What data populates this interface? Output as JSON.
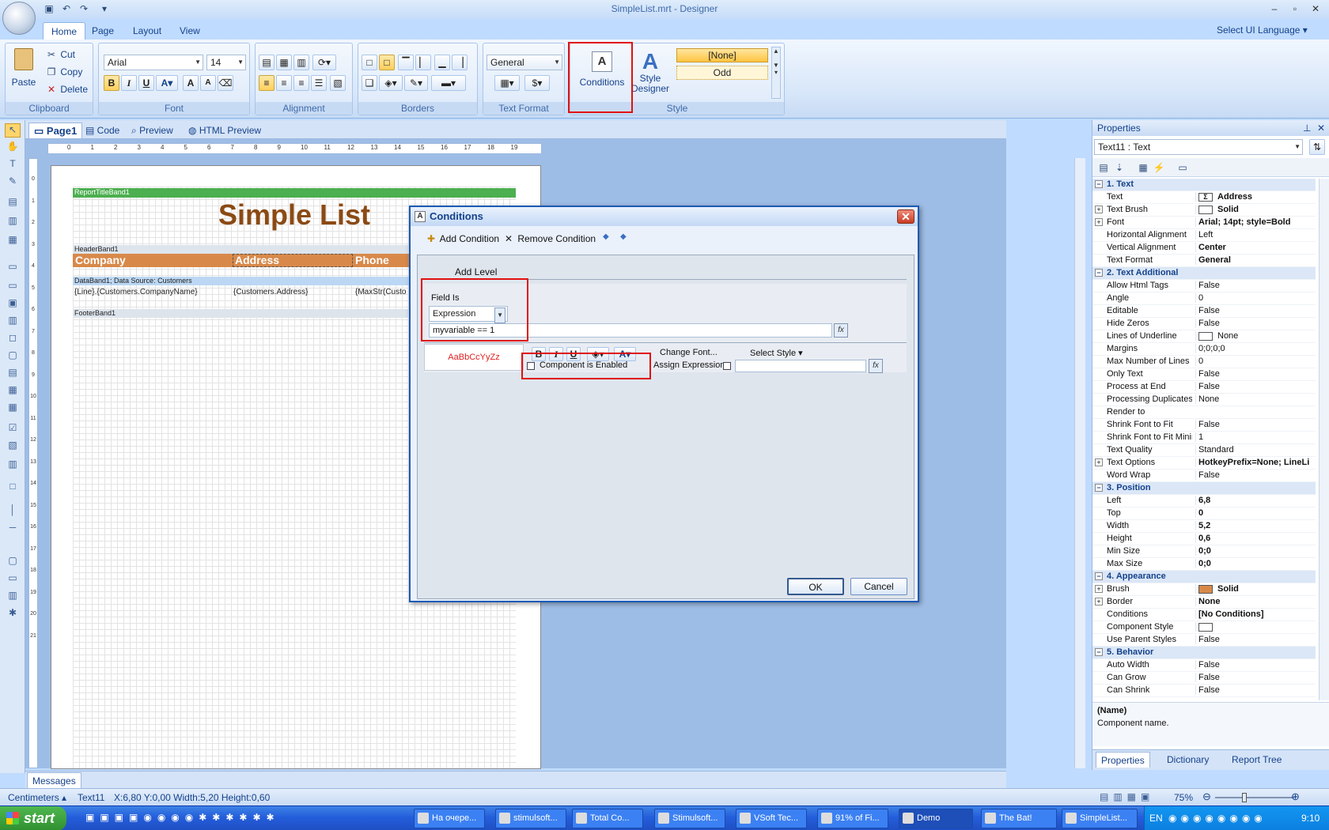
{
  "window": {
    "title": "SimpleList.mrt - Designer"
  },
  "ribbon_tabs": [
    "Home",
    "Page",
    "Layout",
    "View"
  ],
  "ui_language": "Select UI Language",
  "clipboard": {
    "paste": "Paste",
    "cut": "Cut",
    "copy": "Copy",
    "delete": "Delete",
    "label": "Clipboard"
  },
  "font": {
    "name": "Arial",
    "size": "14",
    "label": "Font"
  },
  "alignment": {
    "label": "Alignment"
  },
  "borders": {
    "label": "Borders"
  },
  "text_format": {
    "value": "General",
    "label": "Text Format"
  },
  "conditions_btn": "Conditions",
  "style": {
    "designer": "Style Designer",
    "none": "[None]",
    "odd": "Odd",
    "label": "Style"
  },
  "doc_tabs": [
    "Page1",
    "Code",
    "Preview",
    "HTML Preview"
  ],
  "ruler_marks": [
    "0",
    "1",
    "2",
    "3",
    "4",
    "5",
    "6",
    "7",
    "8",
    "9",
    "10",
    "11",
    "12",
    "13",
    "14",
    "15",
    "16",
    "17",
    "18",
    "19"
  ],
  "vruler_marks": [
    "0",
    "1",
    "2",
    "3",
    "4",
    "5",
    "6",
    "7",
    "8",
    "9",
    "10",
    "11",
    "12",
    "13",
    "14",
    "15",
    "16",
    "17",
    "18",
    "19",
    "20",
    "21"
  ],
  "report": {
    "title_band": "ReportTitleBand1",
    "title": "Simple List",
    "header_band": "HeaderBand1",
    "headers": [
      "Company",
      "Address",
      "Phone"
    ],
    "data_band": "DataBand1; Data Source: Customers",
    "data_cells": [
      "{Line}.{Customers.CompanyName}",
      "{Customers.Address}",
      "{MaxStr(Custo"
    ],
    "footer_band": "FooterBand1"
  },
  "dialog": {
    "title": "Conditions",
    "add_condition": "Add Condition",
    "remove_condition": "Remove Condition",
    "add_level": "Add Level",
    "field_is": "Field Is",
    "field_type": "Expression",
    "expression": "myvariable == 1",
    "sample": "AaBbCcYyZz",
    "change_font": "Change Font...",
    "select_style": "Select Style",
    "component_enabled": "Component is Enabled",
    "assign_expression": "Assign Expression",
    "ok": "OK",
    "cancel": "Cancel"
  },
  "properties": {
    "title": "Properties",
    "selector": "Text11 : Text",
    "rows": [
      {
        "cat": true,
        "name": "1. Text"
      },
      {
        "name": "Text",
        "value": "Address",
        "bold": true,
        "sigma": true
      },
      {
        "name": "Text Brush",
        "value": "Solid",
        "bold": true,
        "expand": true,
        "swatch": "#ffffff"
      },
      {
        "name": "Font",
        "value": "Arial; 14pt; style=Bold",
        "bold": true,
        "expand": true
      },
      {
        "name": "Horizontal Alignment",
        "value": "Left"
      },
      {
        "name": "Vertical Alignment",
        "value": "Center",
        "bold": true
      },
      {
        "name": "Text Format",
        "value": "General",
        "bold": true
      },
      {
        "cat": true,
        "name": "2. Text  Additional"
      },
      {
        "name": "Allow Html Tags",
        "value": "False"
      },
      {
        "name": "Angle",
        "value": "0"
      },
      {
        "name": "Editable",
        "value": "False"
      },
      {
        "name": "Hide Zeros",
        "value": "False"
      },
      {
        "name": "Lines of Underline",
        "value": "None",
        "swatch": "#ffffff"
      },
      {
        "name": "Margins",
        "value": "0;0;0;0"
      },
      {
        "name": "Max Number of Lines",
        "value": "0"
      },
      {
        "name": "Only Text",
        "value": "False"
      },
      {
        "name": "Process at End",
        "value": "False"
      },
      {
        "name": "Processing Duplicates",
        "value": "None"
      },
      {
        "name": "Render to",
        "value": ""
      },
      {
        "name": "Shrink Font to Fit",
        "value": "False"
      },
      {
        "name": "Shrink Font to Fit Minim",
        "value": "1"
      },
      {
        "name": "Text Quality",
        "value": "Standard"
      },
      {
        "name": "Text Options",
        "value": "HotkeyPrefix=None; LineLi",
        "bold": true,
        "expand": true
      },
      {
        "name": "Word Wrap",
        "value": "False"
      },
      {
        "cat": true,
        "name": "3. Position"
      },
      {
        "name": "Left",
        "value": "6,8",
        "bold": true
      },
      {
        "name": "Top",
        "value": "0",
        "bold": true
      },
      {
        "name": "Width",
        "value": "5,2",
        "bold": true
      },
      {
        "name": "Height",
        "value": "0,6",
        "bold": true
      },
      {
        "name": "Min Size",
        "value": "0;0",
        "bold": true
      },
      {
        "name": "Max Size",
        "value": "0;0",
        "bold": true
      },
      {
        "cat": true,
        "name": "4. Appearance"
      },
      {
        "name": "Brush",
        "value": "Solid",
        "bold": true,
        "expand": true,
        "swatch": "#d8894a"
      },
      {
        "name": "Border",
        "value": "None",
        "bold": true,
        "expand": true
      },
      {
        "name": "Conditions",
        "value": "[No Conditions]",
        "bold": true
      },
      {
        "name": "Component Style",
        "value": "",
        "swatch": "#ffffff"
      },
      {
        "name": "Use Parent Styles",
        "value": "False"
      },
      {
        "cat": true,
        "name": "5. Behavior"
      },
      {
        "name": "Auto Width",
        "value": "False"
      },
      {
        "name": "Can Grow",
        "value": "False"
      },
      {
        "name": "Can Shrink",
        "value": "False"
      }
    ],
    "desc_title": "(Name)",
    "desc_text": "Component name.",
    "bottom_tabs": [
      "Properties",
      "Dictionary",
      "Report Tree"
    ]
  },
  "messages": "Messages",
  "status": {
    "units": "Centimeters",
    "component": "Text11",
    "coords": "X:6,80 Y:0,00 Width:5,20 Height:0,60",
    "zoom": "75%"
  },
  "taskbar": {
    "start": "start",
    "tasks": [
      "На очере...",
      "stimulsoft...",
      "Total Co...",
      "Stimulsoft...",
      "VSoft Tec...",
      "91% of Fi...",
      "Demo",
      "The Bat!",
      "SimpleList..."
    ],
    "lang": "EN",
    "clock": "9:10"
  },
  "colors": {
    "header_band": "#d8894a",
    "title_text": "#8b4a14",
    "sample_text": "#e02020",
    "highlight": "#e01010"
  }
}
